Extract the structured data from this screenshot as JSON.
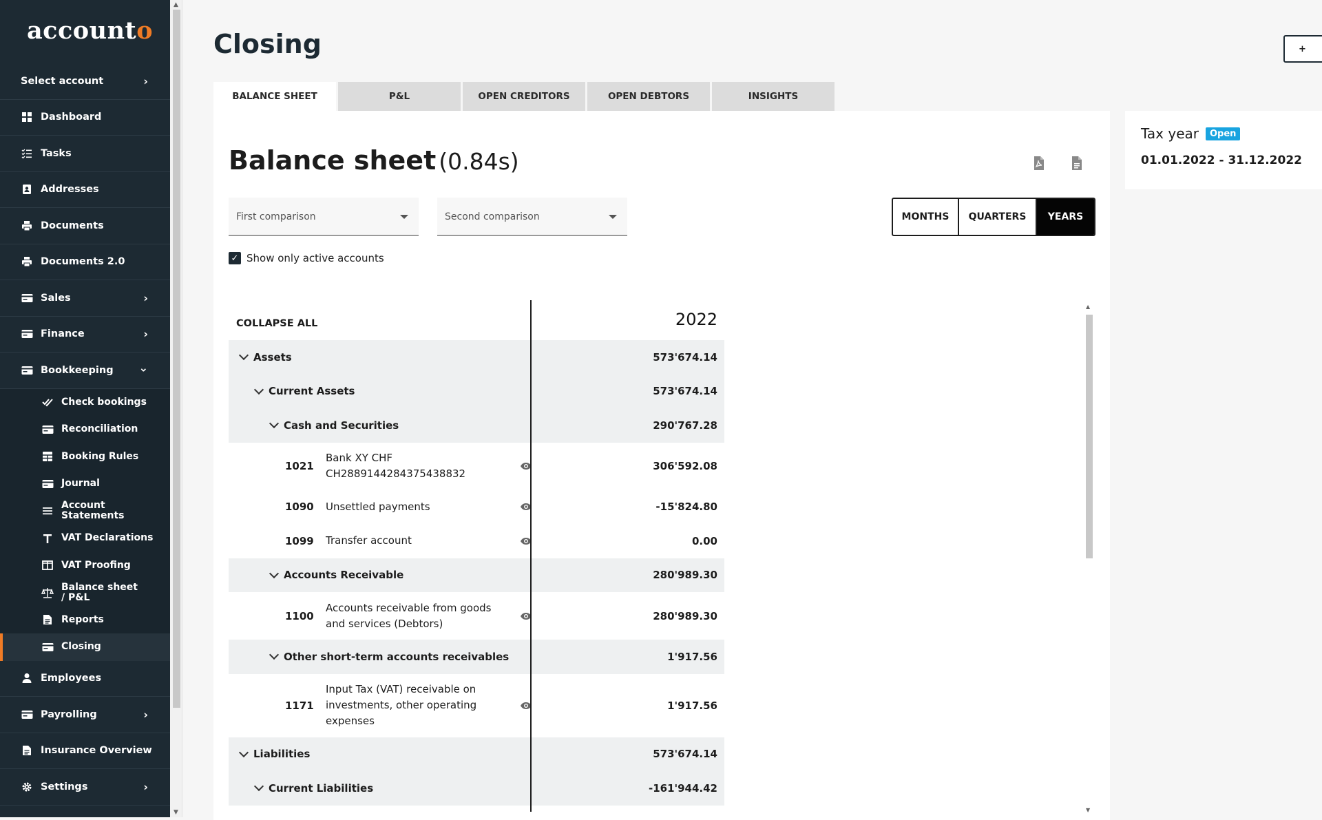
{
  "app": {
    "logo_main": "account",
    "logo_accent": "o"
  },
  "sidebar": {
    "items": [
      {
        "label": "Select account",
        "chev": "›",
        "icon": ""
      },
      {
        "label": "Dashboard",
        "icon": "grid-icon"
      },
      {
        "label": "Tasks",
        "icon": "list-icon"
      },
      {
        "label": "Addresses",
        "icon": "address-book-icon"
      },
      {
        "label": "Documents",
        "icon": "printer-icon"
      },
      {
        "label": "Documents 2.0",
        "icon": "printer-icon"
      },
      {
        "label": "Sales",
        "chev": "›",
        "icon": "card-icon"
      },
      {
        "label": "Finance",
        "chev": "›",
        "icon": "card-icon"
      },
      {
        "label": "Bookkeeping",
        "chev": "⌄",
        "icon": "card-icon"
      }
    ],
    "bookkeeping_sub": [
      {
        "label": "Check bookings",
        "icon": "check-icon"
      },
      {
        "label": "Reconciliation",
        "icon": "card-icon"
      },
      {
        "label": "Booking Rules",
        "icon": "table-icon"
      },
      {
        "label": "Journal",
        "icon": "card-icon"
      },
      {
        "label": "Account Statements",
        "icon": "lines-icon"
      },
      {
        "label": "VAT Declarations",
        "icon": "t-icon"
      },
      {
        "label": "VAT Proofing",
        "icon": "columns-icon"
      },
      {
        "label": "Balance sheet / P&L",
        "icon": "scale-icon"
      },
      {
        "label": "Reports",
        "icon": "report-icon"
      },
      {
        "label": "Closing",
        "icon": "card-icon"
      }
    ],
    "bottom_items": [
      {
        "label": "Employees",
        "icon": "person-icon"
      },
      {
        "label": "Payrolling",
        "chev": "›",
        "icon": "card-icon"
      },
      {
        "label": "Insurance Overview",
        "icon": "report-icon"
      },
      {
        "label": "Settings",
        "chev": "›",
        "icon": "gear-icon"
      }
    ]
  },
  "page": {
    "title": "Closing",
    "top_button": "+"
  },
  "tabs": [
    "BALANCE SHEET",
    "P&L",
    "OPEN CREDITORS",
    "OPEN DEBTORS",
    "INSIGHTS"
  ],
  "balance": {
    "title": "Balance sheet",
    "time": "(0.84s)",
    "first_comparison": "First comparison",
    "second_comparison": "Second comparison",
    "periods": [
      "MONTHS",
      "QUARTERS",
      "YEARS"
    ],
    "active_only": "Show only active accounts",
    "collapse_all": "COLLAPSE ALL",
    "year": "2022"
  },
  "rows": [
    {
      "type": "grp",
      "level": 0,
      "label": "Assets",
      "value": "573'674.14"
    },
    {
      "type": "grp",
      "level": 1,
      "label": "Current Assets",
      "value": "573'674.14"
    },
    {
      "type": "grp",
      "level": 2,
      "label": "Cash and Securities",
      "value": "290'767.28"
    },
    {
      "type": "acc",
      "num": "1021",
      "label": "Bank XY CHF CH2889144284375438832",
      "value": "306'592.08",
      "h": 69
    },
    {
      "type": "acc",
      "num": "1090",
      "label": "Unsettled payments",
      "value": "-15'824.80",
      "h": 49.5
    },
    {
      "type": "acc",
      "num": "1099",
      "label": "Transfer account",
      "value": "0.00",
      "h": 49.5
    },
    {
      "type": "grp",
      "level": 2,
      "label": "Accounts Receivable",
      "value": "280'989.30"
    },
    {
      "type": "acc",
      "num": "1100",
      "label": "Accounts receivable from goods and services (Debtors)",
      "value": "280'989.30",
      "h": 69
    },
    {
      "type": "grp",
      "level": 2,
      "label": "Other short-term accounts receivables",
      "value": "1'917.56"
    },
    {
      "type": "acc",
      "num": "1171",
      "label": "Input Tax (VAT) receivable on investments, other operating expenses",
      "value": "1'917.56",
      "h": 92
    },
    {
      "type": "grp",
      "level": 0,
      "label": "Liabilities",
      "value": "573'674.14"
    },
    {
      "type": "grp",
      "level": 1,
      "label": "Current Liabilities",
      "value": "-161'944.42"
    }
  ],
  "tax": {
    "label": "Tax year",
    "badge": "Open",
    "range": "01.01.2022 - 31.12.2022"
  }
}
